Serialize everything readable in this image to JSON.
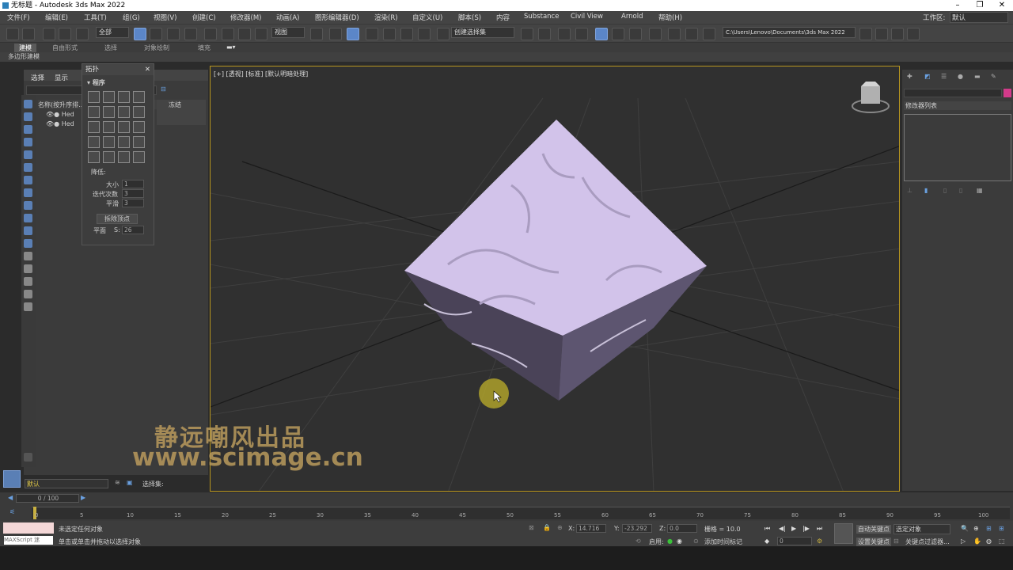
{
  "window": {
    "title": "无标题 - Autodesk 3ds Max 2022",
    "minimize": "–",
    "restore": "❐",
    "close": "✕"
  },
  "menu": [
    "文件(F)",
    "编辑(E)",
    "工具(T)",
    "组(G)",
    "视图(V)",
    "创建(C)",
    "修改器(M)",
    "动画(A)",
    "图形编辑器(D)",
    "渲染(R)",
    "自定义(U)",
    "脚本(S)",
    "内容",
    "Substance",
    "Civil View",
    "Arnold",
    "帮助(H)"
  ],
  "workspace": {
    "label": "工作区:",
    "value": "默认"
  },
  "toolbar": {
    "filter_value": "全部",
    "coord_value": "视图",
    "selection_set": "创建选择集",
    "path": "C:\\Users\\Lenovo\\Documents\\3ds Max 2022"
  },
  "ribbon": {
    "tabs": [
      "建模",
      "自由形式",
      "选择",
      "对象绘制",
      "填充"
    ],
    "sub": "多边形建模"
  },
  "scene_explorer": {
    "tabs": [
      "选择",
      "显示"
    ],
    "header": "名称(按升序排...",
    "col2": "冻结",
    "rows": [
      "Hed",
      "Hed"
    ]
  },
  "float_panel": {
    "title": "拓扑",
    "section": "程序",
    "reduce_label": "降低:",
    "size_label": "大小",
    "size_value": "1",
    "iter_label": "迭代次数",
    "iter_value": "3",
    "smooth_label": "平滑",
    "smooth_value": "3",
    "button": "拆除顶点",
    "plane_label": "平面",
    "s_label": "S:",
    "s_value": "26"
  },
  "viewport": {
    "label": "[+] [透视] [标准] [默认明暗处理]"
  },
  "right_panel": {
    "modifier_list": "修改器列表",
    "swatch_color": "#d23a8a"
  },
  "bottom": {
    "layer_value": "默认",
    "selection_set_label": "选择集:",
    "frame": "0 / 100",
    "ticks": [
      "0",
      "5",
      "10",
      "15",
      "20",
      "25",
      "30",
      "35",
      "40",
      "45",
      "50",
      "55",
      "60",
      "65",
      "70",
      "75",
      "80",
      "85",
      "90",
      "95",
      "100"
    ],
    "status1": "未选定任何对象",
    "status2": "单击或单击并拖动以选择对象",
    "maxscript": "MAXScript 迷",
    "x_label": "X:",
    "x_value": "14.716",
    "y_label": "Y:",
    "y_value": "-23.292",
    "z_label": "Z:",
    "z_value": "0.0",
    "grid": "栅格 = 10.0",
    "enable": "启用:",
    "time_tag": "添加时间标记",
    "auto_key": "自动关键点",
    "selected_obj": "选定对象",
    "set_key": "设置关键点",
    "key_filter": "关键点过滤器...",
    "frame_field": "0"
  },
  "watermark": {
    "line1": "静远嘲风出品",
    "line2": "www.scimage.cn"
  }
}
